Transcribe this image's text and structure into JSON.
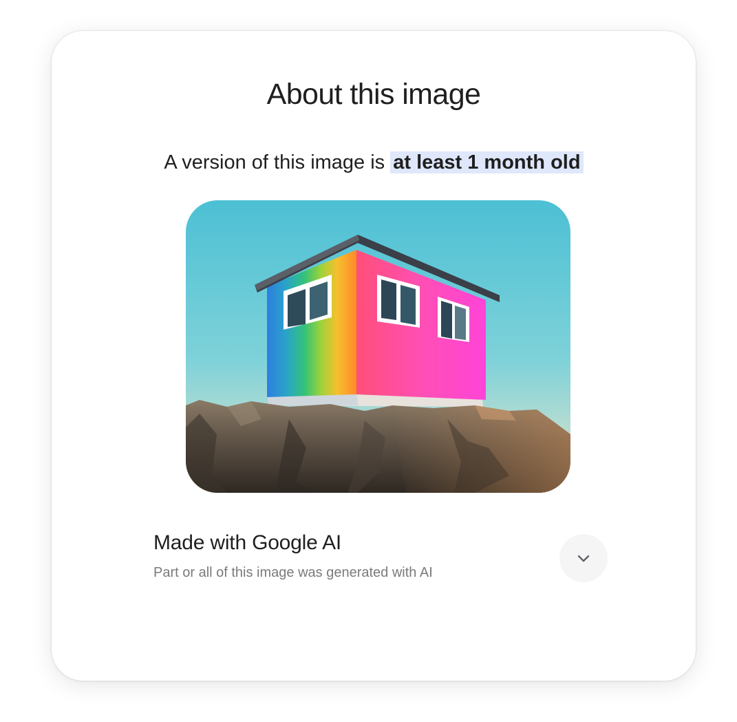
{
  "dialog": {
    "title": "About this image",
    "subtitle_prefix": "A version of this image is ",
    "subtitle_highlight": "at least 1 month old"
  },
  "image": {
    "description_icon": "rainbow-house-on-cliff"
  },
  "ai_section": {
    "title": "Made with Google AI",
    "description": "Part or all of this image was generated with AI",
    "expand_icon": "chevron-down-icon"
  },
  "colors": {
    "highlight": "#dfe7fb",
    "text_primary": "#1f1f1f",
    "text_secondary": "#7a7a7a",
    "button_bg": "#f5f5f5"
  }
}
